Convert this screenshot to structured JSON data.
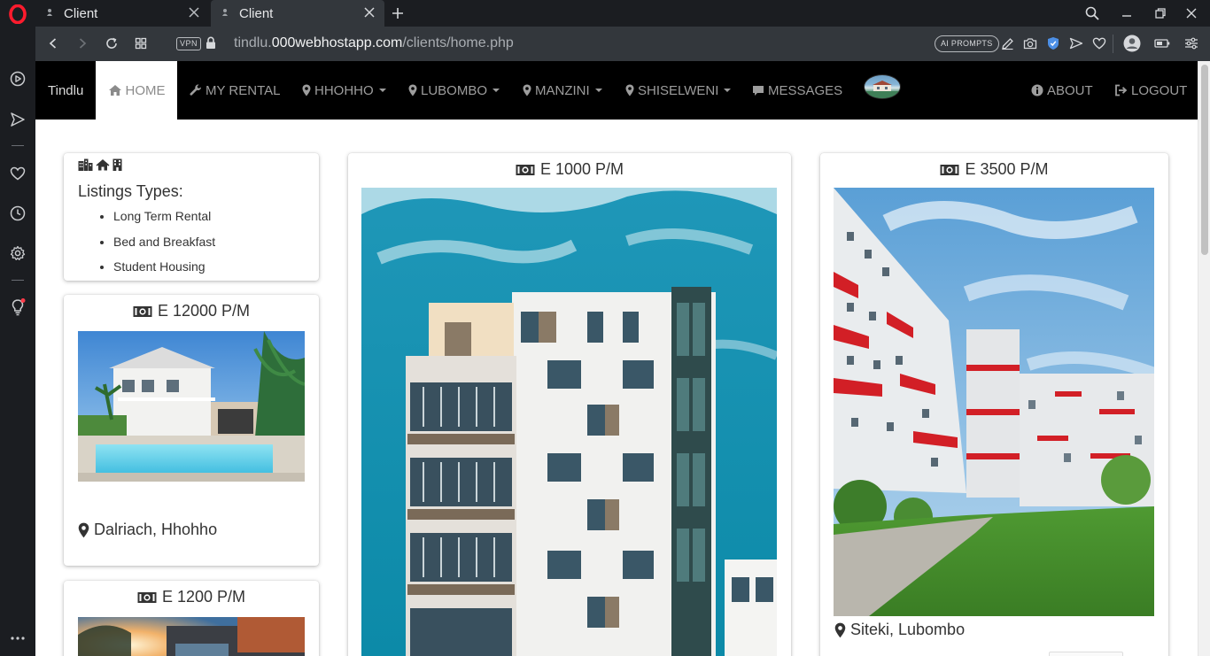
{
  "browser": {
    "tabs": [
      {
        "title": "Client"
      },
      {
        "title": "Client"
      }
    ],
    "address": {
      "vpn_label": "VPN",
      "url_prefix": "tindlu.",
      "url_host": "000webhostapp.com",
      "url_path": "/clients/home.php"
    },
    "ai_prompts_label": "AI PROMPTS"
  },
  "site": {
    "brand": "Tindlu",
    "nav": {
      "home": "HOME",
      "my_rental": "MY RENTAL",
      "hhohho": "HHOHHO",
      "lubombo": "LUBOMBO",
      "manzini": "MANZINI",
      "shiselweni": "SHISELWENI",
      "messages": "MESSAGES",
      "about": "ABOUT",
      "logout": "LOGOUT"
    },
    "listing_types": {
      "title": "Listings Types:",
      "items": [
        "Long Term Rental",
        "Bed and Breakfast",
        "Student Housing"
      ]
    },
    "listings": [
      {
        "price": "E 12000 P/M",
        "location": "Dalriach, Hhohho"
      },
      {
        "price": "E 1200 P/M"
      },
      {
        "price": "E 1000 P/M"
      },
      {
        "price": "E 3500 P/M",
        "location": "Siteki, Lubombo"
      }
    ]
  },
  "colors": {
    "navbar": "#000000",
    "nav_text": "#9d9d9d",
    "browser_chrome": "#33373c",
    "opera_red": "#ff1b2d"
  }
}
